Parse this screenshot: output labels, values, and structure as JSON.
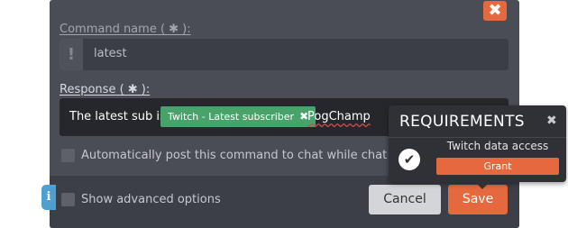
{
  "dialog": {
    "close_symbol": "✖",
    "command_name_label": "Command name ( ✱ ):",
    "command_name_value": "latest",
    "warning_symbol": "!",
    "response_label": "Response ( ✱ ):",
    "response_prefix": "The latest sub is",
    "response_chip": "Twitch - Latest subscriber",
    "response_chip_remove": "✖",
    "response_suffix": "PogChamp",
    "auto_post_label": "Automatically post this command to chat while chat is active",
    "advanced_label": "Show advanced options",
    "info_symbol": "i",
    "cancel_label": "Cancel",
    "save_label": "Save"
  },
  "requirements": {
    "title": "REQUIREMENTS",
    "close_symbol": "✖",
    "check_symbol": "✔",
    "item_label": "Twitch data access",
    "grant_label": "Grant"
  },
  "colors": {
    "accent": "#e5683f",
    "chip": "#48a36b",
    "info": "#4fa0d0",
    "dialog_bg": "#4a4d56"
  }
}
